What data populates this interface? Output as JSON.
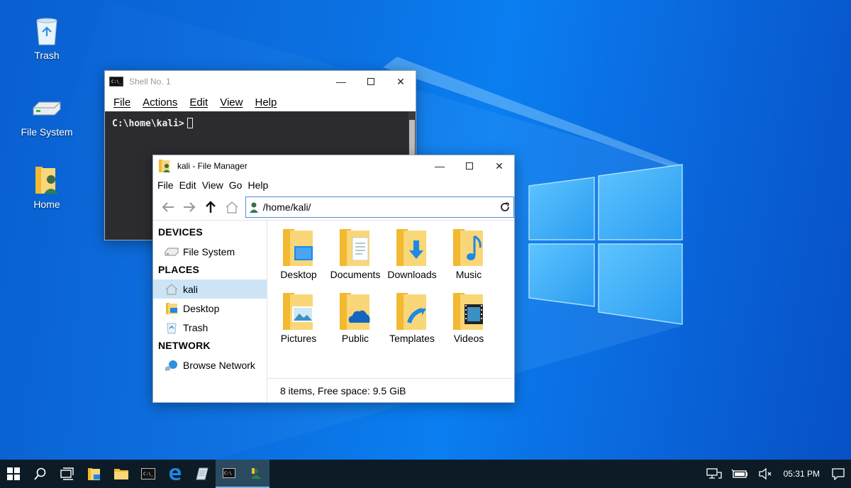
{
  "desktop": {
    "icons": [
      {
        "label": "Trash",
        "icon": "trash-icon"
      },
      {
        "label": "File System",
        "icon": "drive-icon"
      },
      {
        "label": "Home",
        "icon": "home-folder-icon"
      }
    ]
  },
  "terminal": {
    "title": "Shell No. 1",
    "menu": [
      "File",
      "Actions",
      "Edit",
      "View",
      "Help"
    ],
    "prompt": "C:\\home\\kali>"
  },
  "file_manager": {
    "title": "kali - File Manager",
    "menu": [
      "File",
      "Edit",
      "View",
      "Go",
      "Help"
    ],
    "address": "/home/kali/",
    "sidebar": {
      "devices_label": "DEVICES",
      "devices": [
        {
          "label": "File System"
        }
      ],
      "places_label": "PLACES",
      "places": [
        {
          "label": "kali"
        },
        {
          "label": "Desktop"
        },
        {
          "label": "Trash"
        }
      ],
      "network_label": "NETWORK",
      "network": [
        {
          "label": "Browse Network"
        }
      ]
    },
    "items": [
      {
        "label": "Desktop",
        "icon": "desktop-folder-icon"
      },
      {
        "label": "Documents",
        "icon": "documents-folder-icon"
      },
      {
        "label": "Downloads",
        "icon": "downloads-folder-icon"
      },
      {
        "label": "Music",
        "icon": "music-folder-icon"
      },
      {
        "label": "Pictures",
        "icon": "pictures-folder-icon"
      },
      {
        "label": "Public",
        "icon": "public-folder-icon"
      },
      {
        "label": "Templates",
        "icon": "templates-folder-icon"
      },
      {
        "label": "Videos",
        "icon": "videos-folder-icon"
      }
    ],
    "status": "8 items, Free space: 9.5 GiB"
  },
  "taskbar": {
    "clock": "05:31 PM"
  },
  "colors": {
    "folder": "#f6c94a",
    "accent": "#1e88e5",
    "taskbar": "#0d1b26"
  }
}
